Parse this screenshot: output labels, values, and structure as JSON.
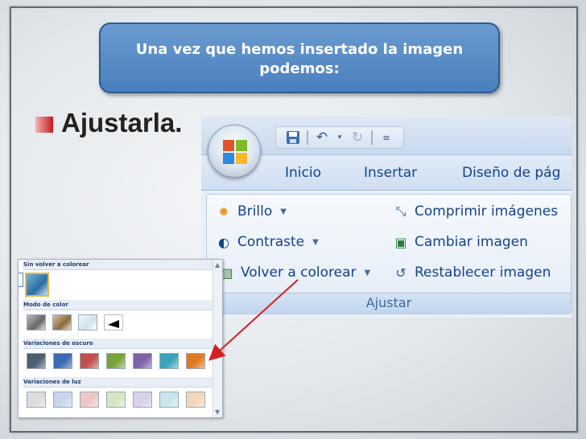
{
  "callout": {
    "line1": "Una vez que hemos insertado  la imagen",
    "line2": "podemos:"
  },
  "bullet": {
    "text": "Ajustarla."
  },
  "ribbon": {
    "tabs": [
      "Inicio",
      "Insertar",
      "Diseño de pág"
    ],
    "items": {
      "brillo": "Brillo",
      "contraste": "Contraste",
      "volver": "Volver a colorear",
      "comprimir": "Comprimir imágenes",
      "cambiar": "Cambiar imagen",
      "restablecer": "Restablecer imagen"
    },
    "group_label": "Ajustar"
  },
  "gallery": {
    "headers": [
      "Sin volver a colorear",
      "Modo de color",
      "Variaciones de oscuro",
      "Variaciones de luz"
    ],
    "dark_colors": [
      "#4e5e72",
      "#3b6bb0",
      "#c0504d",
      "#77a33a",
      "#7e63a8",
      "#3aa3b8",
      "#e07a22"
    ],
    "light_colors": [
      "#dcdcdc",
      "#c7d6ec",
      "#ecc7c6",
      "#d6e6c1",
      "#d9d0e8",
      "#c6e5ec",
      "#f5d6ba"
    ]
  },
  "colors": {
    "callout": "#4a7fbf",
    "bullet": "#c41b1b",
    "ribbon_text": "#15428b",
    "arrow": "#d62020"
  }
}
